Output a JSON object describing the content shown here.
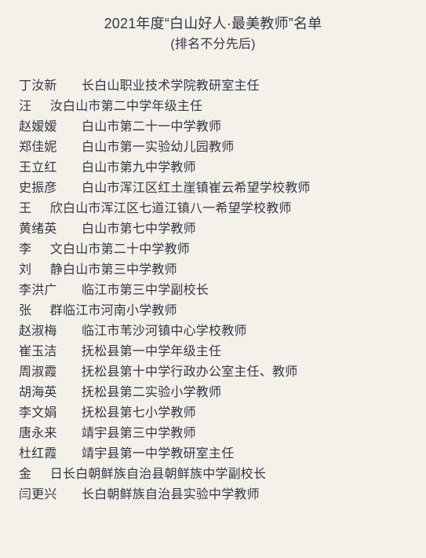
{
  "document": {
    "title": "2021年度“白山好人·最美教师”名单",
    "subtitle": "(排名不分先后)",
    "background_color": "#f4f0ea",
    "text_color": "#333845"
  },
  "list": {
    "entries": [
      {
        "name": "丁汝新",
        "spread": false,
        "description": "长白山职业技术学院教研室主任"
      },
      {
        "name": "汪汝",
        "spread": true,
        "description": "白山市第二中学年级主任"
      },
      {
        "name": "赵嫒嫒",
        "spread": false,
        "description": "白山市第二十一中学教师"
      },
      {
        "name": "郑佳妮",
        "spread": false,
        "description": "白山市第一实验幼儿园教师"
      },
      {
        "name": "王立红",
        "spread": false,
        "description": "白山市第九中学教师"
      },
      {
        "name": "史振彦",
        "spread": false,
        "description": "白山市浑江区红土崖镇崔云希望学校教师"
      },
      {
        "name": "王欣",
        "spread": true,
        "description": "白山市浑江区七道江镇八一希望学校教师"
      },
      {
        "name": "黄绪英",
        "spread": false,
        "description": "白山市第七中学教师"
      },
      {
        "name": "李文",
        "spread": true,
        "description": "白山市第二十中学教师"
      },
      {
        "name": "刘静",
        "spread": true,
        "description": "白山市第三中学教师"
      },
      {
        "name": "李洪广",
        "spread": false,
        "description": "临江市第三中学副校长"
      },
      {
        "name": "张群",
        "spread": true,
        "description": "临江市河南小学教师"
      },
      {
        "name": "赵淑梅",
        "spread": false,
        "description": "临江市苇沙河镇中心学校教师"
      },
      {
        "name": "崔玉洁",
        "spread": false,
        "description": "抚松县第一中学年级主任"
      },
      {
        "name": "周淑霞",
        "spread": false,
        "description": "抚松县第十中学行政办公室主任、教师"
      },
      {
        "name": "胡海英",
        "spread": false,
        "description": "抚松县第二实验小学教师"
      },
      {
        "name": "李文娟",
        "spread": false,
        "description": "抚松县第七小学教师"
      },
      {
        "name": "唐永来",
        "spread": false,
        "description": "靖宇县第三中学教师"
      },
      {
        "name": "杜红霞",
        "spread": false,
        "description": "靖宇县第一中学教研室主任"
      },
      {
        "name": "金日",
        "spread": true,
        "description": "长白朝鲜族自治县朝鲜族中学副校长"
      },
      {
        "name": "闫更兴",
        "spread": false,
        "description": "长白朝鲜族自治县实验中学教师"
      }
    ]
  }
}
